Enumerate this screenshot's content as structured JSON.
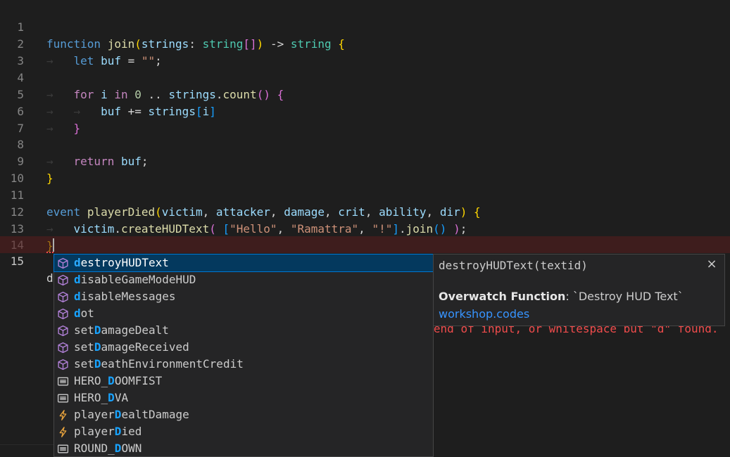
{
  "editor": {
    "line_numbers": [
      "1",
      "2",
      "3",
      "4",
      "5",
      "6",
      "7",
      "8",
      "9",
      "10",
      "11",
      "12",
      "13",
      "14",
      "15"
    ],
    "active_line": "15",
    "typed_text": "d",
    "error_message": "Expected \";\", \"event\", \"function\", \"type\", comment, end of input, or whitespace but \"d\" found."
  },
  "code": {
    "l1": {
      "kw": "function",
      "name": "join",
      "p1": "(",
      "param": "strings",
      "colon": ":",
      "type1": "string",
      "br": "[]",
      "p2": ")",
      "arrow": "->",
      "type2": "string",
      "open": "{"
    },
    "l2": {
      "kw": "let",
      "var": "buf",
      "eq": "=",
      "str": "\"\"",
      "semi": ";"
    },
    "l4": {
      "kw": "for",
      "var": "i",
      "in": "in",
      "num": "0",
      "range": "..",
      "obj": "strings",
      "dot": ".",
      "method": "count",
      "paren": "()",
      "open": "{"
    },
    "l5": {
      "var": "buf",
      "op": "+=",
      "obj": "strings",
      "ob": "[",
      "idx": "i",
      "cb": "]"
    },
    "l6": {
      "close": "}"
    },
    "l8": {
      "kw": "return",
      "var": "buf",
      "semi": ";"
    },
    "l9": {
      "close": "}"
    },
    "l11": {
      "kw": "event",
      "name": "playerDied",
      "p1": "(",
      "a1": "victim",
      "a2": "attacker",
      "a3": "damage",
      "a4": "crit",
      "a5": "ability",
      "a6": "dir",
      "p2": ")",
      "open": "{",
      "comma": ","
    },
    "l12": {
      "obj": "victim",
      "dot": ".",
      "method": "createHUDText",
      "p1": "(",
      "ob": "[",
      "s1": "\"Hello\"",
      "s2": "\"Ramattra\"",
      "s3": "\"!\"",
      "cb": "]",
      "join": "join",
      "paren": "()",
      "p2": ")",
      "semi": ";",
      "comma": ","
    },
    "l13": {
      "close": "}"
    }
  },
  "suggestions": [
    {
      "pre": "",
      "hl": "d",
      "post": "estroyHUDText",
      "kind": "cube-icon",
      "selected": true
    },
    {
      "pre": "",
      "hl": "d",
      "post": "isableGameModeHUD",
      "kind": "cube-icon"
    },
    {
      "pre": "",
      "hl": "d",
      "post": "isableMessages",
      "kind": "cube-icon"
    },
    {
      "pre": "",
      "hl": "d",
      "post": "ot",
      "kind": "cube-icon"
    },
    {
      "pre": "set",
      "hl": "D",
      "post": "amageDealt",
      "kind": "cube-icon"
    },
    {
      "pre": "set",
      "hl": "D",
      "post": "amageReceived",
      "kind": "cube-icon"
    },
    {
      "pre": "set",
      "hl": "D",
      "post": "eathEnvironmentCredit",
      "kind": "cube-icon"
    },
    {
      "pre": "HERO_",
      "hl": "D",
      "post": "OOMFIST",
      "kind": "enum-icon"
    },
    {
      "pre": "HERO_",
      "hl": "D",
      "post": "VA",
      "kind": "enum-icon"
    },
    {
      "pre": "player",
      "hl": "D",
      "post": "ealtDamage",
      "kind": "event-icon"
    },
    {
      "pre": "player",
      "hl": "D",
      "post": "ied",
      "kind": "event-icon"
    },
    {
      "pre": "ROUND_",
      "hl": "D",
      "post": "OWN",
      "kind": "enum-icon"
    }
  ],
  "details": {
    "signature": "destroyHUDText(textid)",
    "close_glyph": "×",
    "doc_label": "Overwatch Function",
    "doc_text": ": `Destroy HUD Text`",
    "link": "workshop.codes"
  },
  "colors": {
    "cube": "#b180d7",
    "enum": "#cccccc",
    "event": "#e8a33d",
    "match": "#18a3ff",
    "error": "#f14c4c"
  }
}
